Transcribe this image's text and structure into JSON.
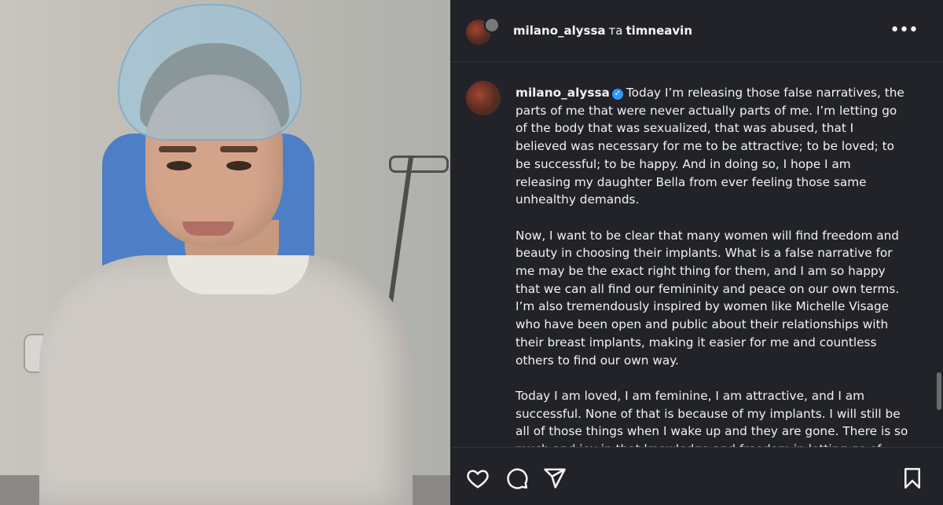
{
  "header": {
    "username": "milano_alyssa",
    "separator": "та",
    "collaborator": "timneavin",
    "more_label": "•••"
  },
  "post": {
    "username": "milano_alyssa",
    "verified_icon": "verified-check-icon",
    "paragraph1": "Today I’m releasing those false narratives, the parts of me that were never actually parts of me. I’m letting go of the body that was sexualized, that was abused, that I believed was necessary for me to be attractive; to be loved; to be successful; to be happy. And in doing so, I hope I am releasing my daughter Bella from ever feeling those same unhealthy demands.",
    "paragraph2": "Now, I want to be clear that many women will find freedom and beauty in choosing their implants. What is a false narrative for me may be the exact right thing for them, and I am so happy that we can all find our femininity and peace on our own terms. I’m also tremendously inspired by women like Michelle Visage who have been open and public about their relationships with their breast implants, making it easier for me and countless others to find our own way.",
    "paragraph3": "Today I am loved, I am feminine, I am attractive, and I am successful. None of that is because of my implants. I will still be all of those things when I wake up and they are gone. There is so much and joy in that knowledge and freedom in letting go of what was never me in the first place."
  },
  "actions": {
    "icons": [
      "heart-icon",
      "comment-icon",
      "share-icon",
      "bookmark-icon"
    ]
  },
  "colors": {
    "panel_bg": "#212328",
    "verified": "#2f97ff",
    "text": "#f5f5f5"
  }
}
